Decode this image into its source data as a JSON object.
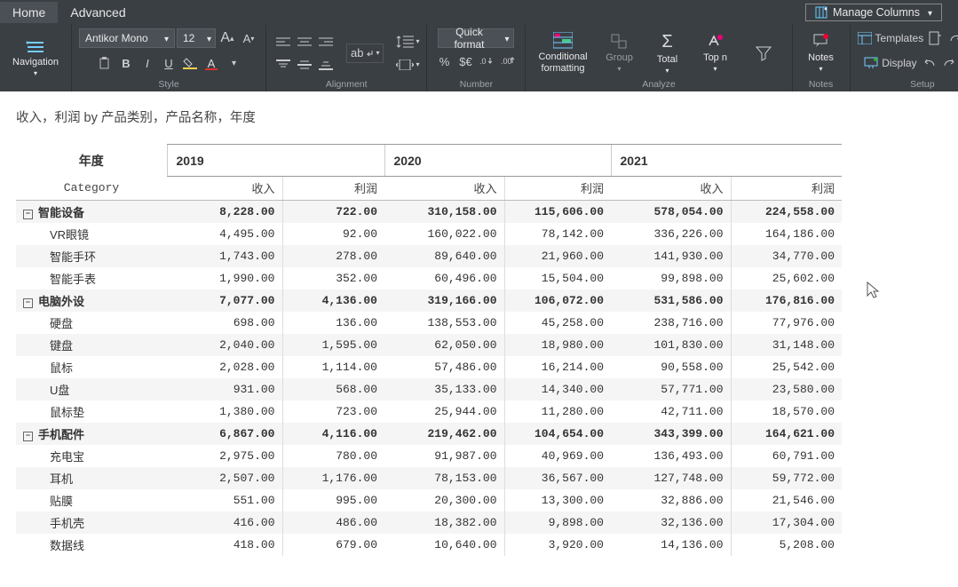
{
  "tabs": {
    "home": "Home",
    "advanced": "Advanced"
  },
  "manage_columns": "Manage Columns",
  "groups": {
    "nav": "Navigation",
    "style": "Style",
    "alignment": "Alignment",
    "number": "Number",
    "analyze": "Analyze",
    "notes": "Notes",
    "setup": "Setup"
  },
  "font_name": "Antikor Mono",
  "font_size": "12",
  "quick_format": "Quick format",
  "cond_fmt": "Conditional formatting",
  "group_btn": "Group",
  "total_btn": "Total",
  "topn_btn": "Top n",
  "notes_btn": "Notes",
  "templates_btn": "Templates",
  "display_btn": "Display",
  "report_title": "收入，利润 by 产品类别，产品名称，年度",
  "headers": {
    "year": "年度",
    "category": "Category",
    "rev": "收入",
    "prof": "利润"
  },
  "years": [
    "2019",
    "2020",
    "2021"
  ],
  "chart_data": {
    "type": "table",
    "columns": [
      "产品类别",
      "产品名称",
      "年度",
      "收入",
      "利润"
    ],
    "categories": [
      {
        "name": "智能设备",
        "totals": [
          [
            "8,228.00",
            "722.00"
          ],
          [
            "310,158.00",
            "115,606.00"
          ],
          [
            "578,054.00",
            "224,558.00"
          ]
        ],
        "products": [
          {
            "name": "VR眼镜",
            "vals": [
              [
                "4,495.00",
                "92.00"
              ],
              [
                "160,022.00",
                "78,142.00"
              ],
              [
                "336,226.00",
                "164,186.00"
              ]
            ]
          },
          {
            "name": "智能手环",
            "vals": [
              [
                "1,743.00",
                "278.00"
              ],
              [
                "89,640.00",
                "21,960.00"
              ],
              [
                "141,930.00",
                "34,770.00"
              ]
            ]
          },
          {
            "name": "智能手表",
            "vals": [
              [
                "1,990.00",
                "352.00"
              ],
              [
                "60,496.00",
                "15,504.00"
              ],
              [
                "99,898.00",
                "25,602.00"
              ]
            ]
          }
        ]
      },
      {
        "name": "电脑外设",
        "totals": [
          [
            "7,077.00",
            "4,136.00"
          ],
          [
            "319,166.00",
            "106,072.00"
          ],
          [
            "531,586.00",
            "176,816.00"
          ]
        ],
        "products": [
          {
            "name": "硬盘",
            "vals": [
              [
                "698.00",
                "136.00"
              ],
              [
                "138,553.00",
                "45,258.00"
              ],
              [
                "238,716.00",
                "77,976.00"
              ]
            ]
          },
          {
            "name": "键盘",
            "vals": [
              [
                "2,040.00",
                "1,595.00"
              ],
              [
                "62,050.00",
                "18,980.00"
              ],
              [
                "101,830.00",
                "31,148.00"
              ]
            ]
          },
          {
            "name": "鼠标",
            "vals": [
              [
                "2,028.00",
                "1,114.00"
              ],
              [
                "57,486.00",
                "16,214.00"
              ],
              [
                "90,558.00",
                "25,542.00"
              ]
            ]
          },
          {
            "name": "U盘",
            "vals": [
              [
                "931.00",
                "568.00"
              ],
              [
                "35,133.00",
                "14,340.00"
              ],
              [
                "57,771.00",
                "23,580.00"
              ]
            ]
          },
          {
            "name": "鼠标垫",
            "vals": [
              [
                "1,380.00",
                "723.00"
              ],
              [
                "25,944.00",
                "11,280.00"
              ],
              [
                "42,711.00",
                "18,570.00"
              ]
            ]
          }
        ]
      },
      {
        "name": "手机配件",
        "totals": [
          [
            "6,867.00",
            "4,116.00"
          ],
          [
            "219,462.00",
            "104,654.00"
          ],
          [
            "343,399.00",
            "164,621.00"
          ]
        ],
        "products": [
          {
            "name": "充电宝",
            "vals": [
              [
                "2,975.00",
                "780.00"
              ],
              [
                "91,987.00",
                "40,969.00"
              ],
              [
                "136,493.00",
                "60,791.00"
              ]
            ]
          },
          {
            "name": "耳机",
            "vals": [
              [
                "2,507.00",
                "1,176.00"
              ],
              [
                "78,153.00",
                "36,567.00"
              ],
              [
                "127,748.00",
                "59,772.00"
              ]
            ]
          },
          {
            "name": "贴膜",
            "vals": [
              [
                "551.00",
                "995.00"
              ],
              [
                "20,300.00",
                "13,300.00"
              ],
              [
                "32,886.00",
                "21,546.00"
              ]
            ]
          },
          {
            "name": "手机壳",
            "vals": [
              [
                "416.00",
                "486.00"
              ],
              [
                "18,382.00",
                "9,898.00"
              ],
              [
                "32,136.00",
                "17,304.00"
              ]
            ]
          },
          {
            "name": "数据线",
            "vals": [
              [
                "418.00",
                "679.00"
              ],
              [
                "10,640.00",
                "3,920.00"
              ],
              [
                "14,136.00",
                "5,208.00"
              ]
            ]
          }
        ]
      }
    ]
  }
}
